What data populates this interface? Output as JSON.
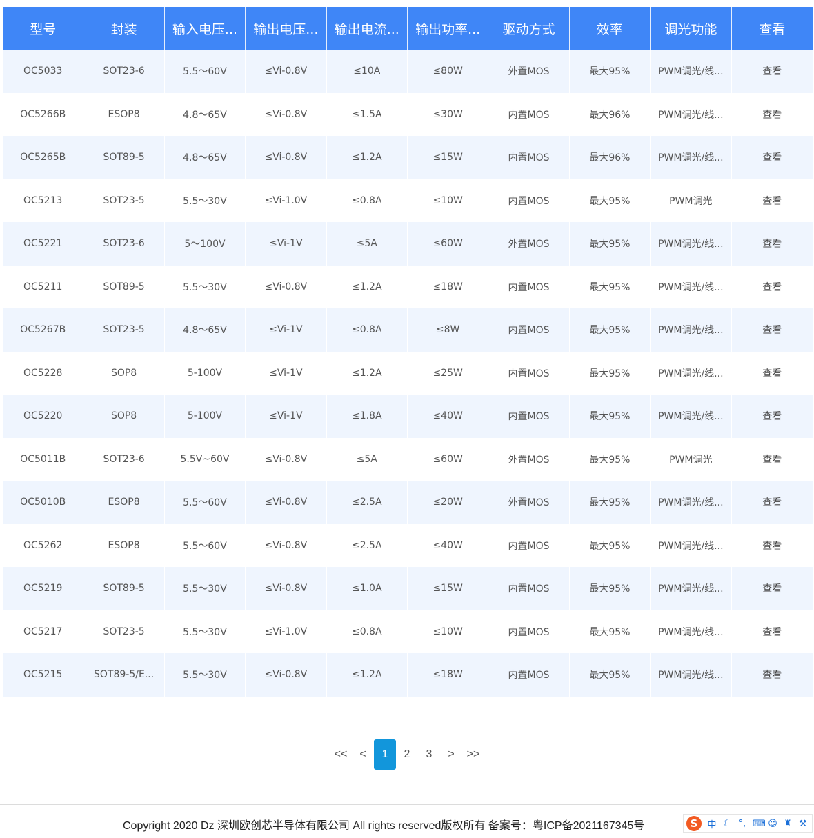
{
  "table": {
    "headers": [
      "型号",
      "封装",
      "输入电压...",
      "输出电压...",
      "输出电流...",
      "输出功率...",
      "驱动方式",
      "效率",
      "调光功能",
      "查看"
    ],
    "rows": [
      [
        "OC5033",
        "SOT23-6",
        "5.5～60V",
        "≤Vi-0.8V",
        "≤10A",
        "≤80W",
        "外置MOS",
        "最大95%",
        "PWM调光/线...",
        "查看"
      ],
      [
        "OC5266B",
        "ESOP8",
        "4.8～65V",
        "≤Vi-0.8V",
        "≤1.5A",
        "≤30W",
        "内置MOS",
        "最大96%",
        "PWM调光/线...",
        "查看"
      ],
      [
        "OC5265B",
        "SOT89-5",
        "4.8～65V",
        "≤Vi-0.8V",
        "≤1.2A",
        "≤15W",
        "内置MOS",
        "最大96%",
        "PWM调光/线...",
        "查看"
      ],
      [
        "OC5213",
        "SOT23-5",
        "5.5～30V",
        "≤Vi-1.0V",
        "≤0.8A",
        "≤10W",
        "内置MOS",
        "最大95%",
        "PWM调光",
        "查看"
      ],
      [
        "OC5221",
        "SOT23-6",
        "5～100V",
        "≤Vi-1V",
        "≤5A",
        "≤60W",
        "外置MOS",
        "最大95%",
        "PWM调光/线...",
        "查看"
      ],
      [
        "OC5211",
        "SOT89-5",
        "5.5～30V",
        "≤Vi-0.8V",
        "≤1.2A",
        "≤18W",
        "内置MOS",
        "最大95%",
        "PWM调光/线...",
        "查看"
      ],
      [
        "OC5267B",
        "SOT23-5",
        "4.8～65V",
        "≤Vi-1V",
        "≤0.8A",
        "≤8W",
        "内置MOS",
        "最大95%",
        "PWM调光/线...",
        "查看"
      ],
      [
        "OC5228",
        "SOP8",
        "5-100V",
        "≤Vi-1V",
        "≤1.2A",
        "≤25W",
        "内置MOS",
        "最大95%",
        "PWM调光/线...",
        "查看"
      ],
      [
        "OC5220",
        "SOP8",
        "5-100V",
        "≤Vi-1V",
        "≤1.8A",
        "≤40W",
        "内置MOS",
        "最大95%",
        "PWM调光/线...",
        "查看"
      ],
      [
        "OC5011B",
        "SOT23-6",
        "5.5V~60V",
        "≤Vi-0.8V",
        "≤5A",
        "≤60W",
        "外置MOS",
        "最大95%",
        "PWM调光",
        "查看"
      ],
      [
        "OC5010B",
        "ESOP8",
        "5.5～60V",
        "≤Vi-0.8V",
        "≤2.5A",
        "≤20W",
        "外置MOS",
        "最大95%",
        "PWM调光/线...",
        "查看"
      ],
      [
        "OC5262",
        "ESOP8",
        "5.5～60V",
        "≤Vi-0.8V",
        "≤2.5A",
        "≤40W",
        "内置MOS",
        "最大95%",
        "PWM调光/线...",
        "查看"
      ],
      [
        "OC5219",
        "SOT89-5",
        "5.5～30V",
        "≤Vi-0.8V",
        "≤1.0A",
        "≤15W",
        "内置MOS",
        "最大95%",
        "PWM调光/线...",
        "查看"
      ],
      [
        "OC5217",
        "SOT23-5",
        "5.5～30V",
        "≤Vi-1.0V",
        "≤0.8A",
        "≤10W",
        "内置MOS",
        "最大95%",
        "PWM调光/线...",
        "查看"
      ],
      [
        "OC5215",
        "SOT89-5/E...",
        "5.5～30V",
        "≤Vi-0.8V",
        "≤1.2A",
        "≤18W",
        "内置MOS",
        "最大95%",
        "PWM调光/线...",
        "查看"
      ]
    ]
  },
  "pagination": {
    "first": "<<",
    "prev": "<",
    "pages": [
      "1",
      "2",
      "3"
    ],
    "active_page": "1",
    "next": ">",
    "last": ">>"
  },
  "footer": {
    "text": "Copyright 2020 Dz 深圳欧创芯半导体有限公司 All rights reserved版权所有 备案号：粤ICP备2021167345号"
  },
  "ime_toolbar": {
    "logo": "S",
    "items": [
      {
        "icon": "chinese-mode-icon",
        "glyph": "中"
      },
      {
        "icon": "moon-icon",
        "glyph": "☾"
      },
      {
        "icon": "punctuation-icon",
        "glyph": "°,"
      },
      {
        "icon": "keyboard-icon",
        "glyph": "⌨"
      },
      {
        "icon": "user-icon",
        "glyph": "☺"
      },
      {
        "icon": "shirt-icon",
        "glyph": "♜"
      },
      {
        "icon": "wrench-icon",
        "glyph": "⚒"
      }
    ]
  },
  "colors": {
    "header_bg": "#3f86f7",
    "stripe_bg": "#eff5fe",
    "active_page_bg": "#1296db"
  }
}
